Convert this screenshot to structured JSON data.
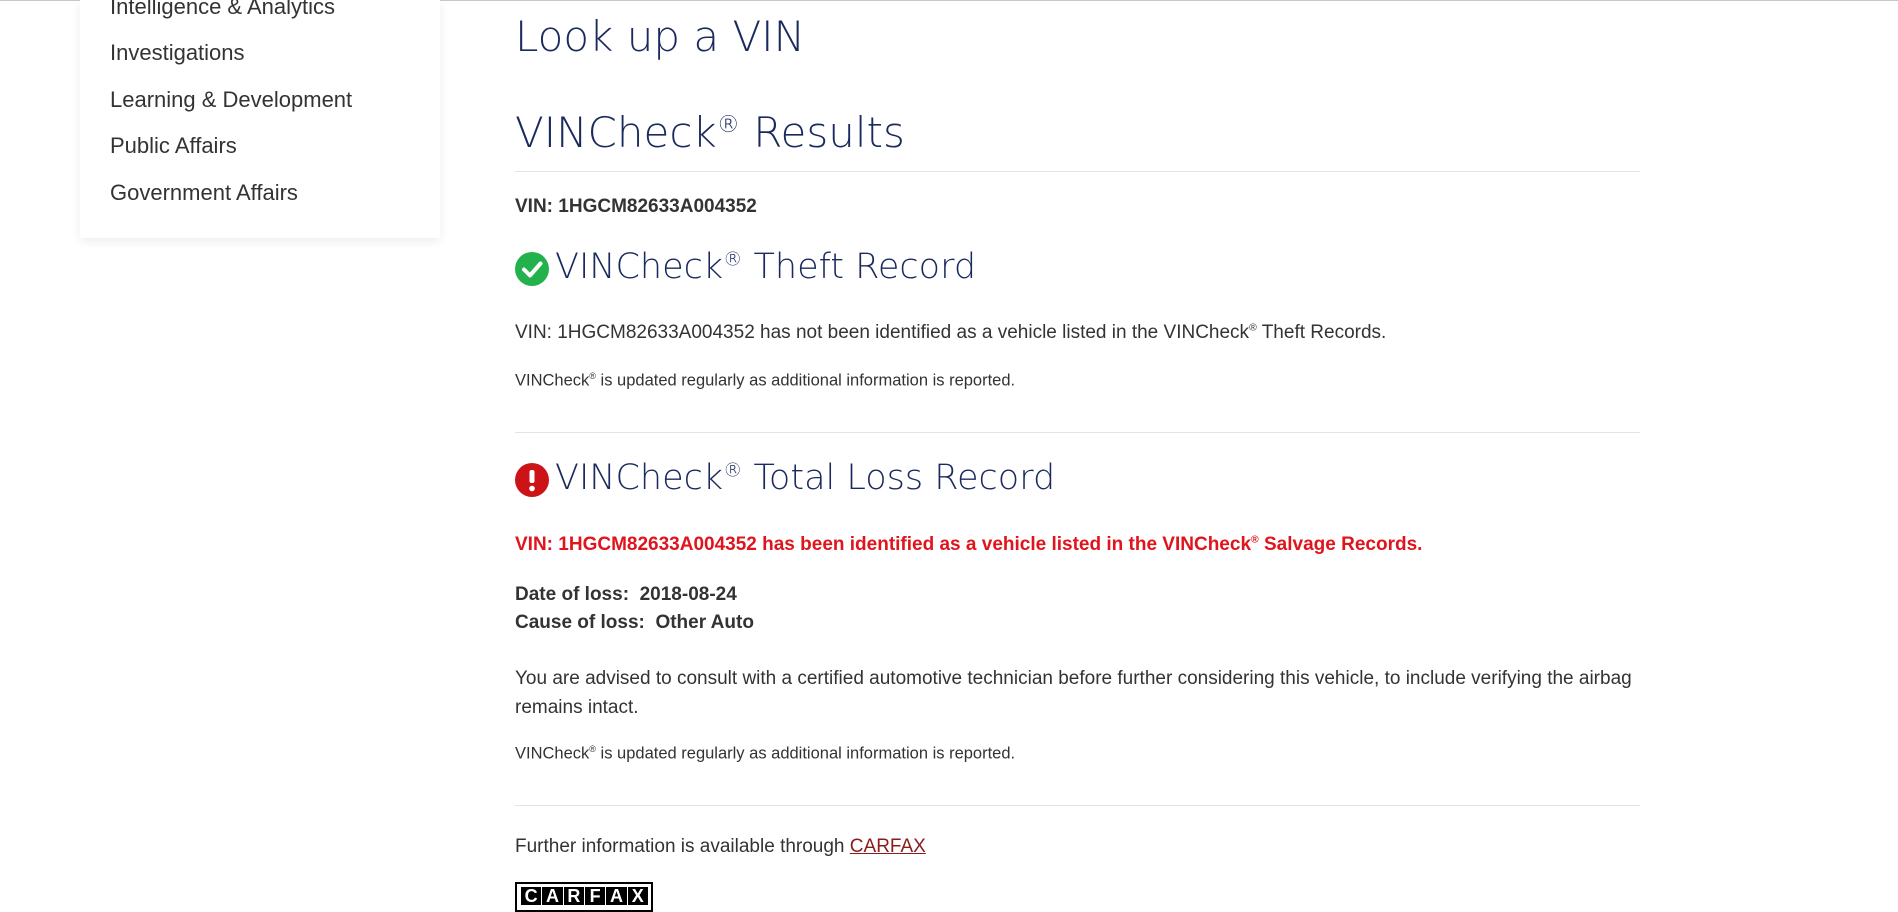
{
  "sidebar": {
    "items": [
      {
        "label": "Intelligence & Analytics"
      },
      {
        "label": "Investigations"
      },
      {
        "label": "Learning & Development"
      },
      {
        "label": "Public Affairs"
      },
      {
        "label": "Government Affairs"
      }
    ]
  },
  "page": {
    "title": "Look up a VIN",
    "results_heading": "VINCheck",
    "results_heading_sup": "®",
    "results_heading_rest": " Results",
    "vin_line": "VIN: 1HGCM82633A004352"
  },
  "theft": {
    "icon": "check-circle-icon",
    "icon_color": "#22b14c",
    "heading": "VINCheck",
    "heading_sup": "®",
    "heading_rest": " Theft Record",
    "message_pre": "VIN: 1HGCM82633A004352 has not been identified as a vehicle listed in the VINCheck",
    "message_sup": "®",
    "message_post": " Theft Records.",
    "update_note_pre": "VINCheck",
    "update_note_sup": "®",
    "update_note_post": " is updated regularly as additional information is reported."
  },
  "total_loss": {
    "icon": "exclamation-circle-icon",
    "icon_color": "#cc1418",
    "heading": "VINCheck",
    "heading_sup": "®",
    "heading_rest": " Total Loss Record",
    "message_pre": "VIN: 1HGCM82633A004352 has been identified as a vehicle listed in the VINCheck",
    "message_sup": "®",
    "message_post": " Salvage Records.",
    "date_label": "Date of loss:",
    "date_value": "2018-08-24",
    "cause_label": "Cause of loss:",
    "cause_value": "Other Auto",
    "advice": "You are advised to consult with a certified automotive technician before further considering this vehicle, to include verifying the airbag remains intact.",
    "update_note_pre": "VINCheck",
    "update_note_sup": "®",
    "update_note_post": " is updated regularly as additional information is reported."
  },
  "footer": {
    "further_info": "Further information is available through ",
    "carfax_link": "CARFAX",
    "carfax_logo_text": "CARFAX"
  },
  "colors": {
    "heading": "#1b2a5e",
    "alert_red": "#e0141c",
    "link": "#8b1c1c"
  }
}
